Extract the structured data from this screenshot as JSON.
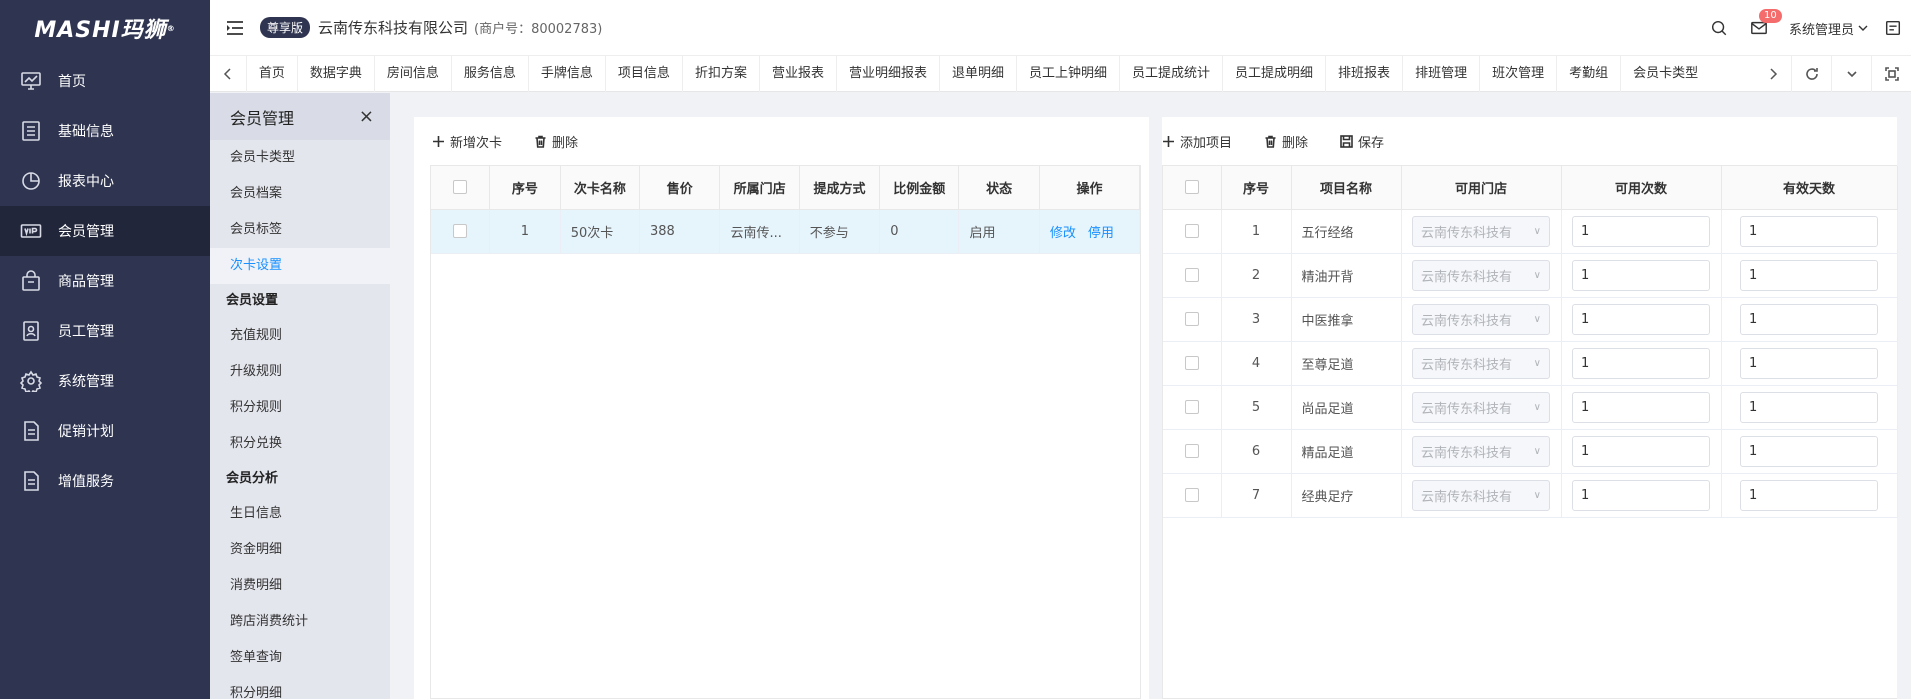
{
  "sidebar": {
    "logo": "MASHI玛狮",
    "logo_mark": "®",
    "items": [
      {
        "label": "首页",
        "icon": "chart-monitor-icon"
      },
      {
        "label": "基础信息",
        "icon": "document-list-icon"
      },
      {
        "label": "报表中心",
        "icon": "pie-chart-icon"
      },
      {
        "label": "会员管理",
        "icon": "vip-card-icon",
        "active": true
      },
      {
        "label": "商品管理",
        "icon": "shopping-bag-icon"
      },
      {
        "label": "员工管理",
        "icon": "employee-card-icon"
      },
      {
        "label": "系统管理",
        "icon": "gear-icon"
      },
      {
        "label": "促销计划",
        "icon": "document-icon"
      },
      {
        "label": "增值服务",
        "icon": "document-icon"
      }
    ]
  },
  "header": {
    "edition": "尊享版",
    "company": "云南传东科技有限公司",
    "merchant": "(商户号：80002783)",
    "mail_count": "10",
    "user": "系统管理员"
  },
  "tabs": [
    "首页",
    "数据字典",
    "房间信息",
    "服务信息",
    "手牌信息",
    "项目信息",
    "折扣方案",
    "营业报表",
    "营业明细报表",
    "退单明细",
    "员工上钟明细",
    "员工提成统计",
    "员工提成明细",
    "排班报表",
    "排班管理",
    "班次管理",
    "考勤组",
    "会员卡类型"
  ],
  "submenu": {
    "title": "会员管理",
    "close": "×",
    "items": [
      {
        "type": "item",
        "label": "会员卡类型"
      },
      {
        "type": "item",
        "label": "会员档案"
      },
      {
        "type": "item",
        "label": "会员标签"
      },
      {
        "type": "item",
        "label": "次卡设置",
        "active": true
      },
      {
        "type": "group",
        "label": "会员设置"
      },
      {
        "type": "item",
        "label": "充值规则"
      },
      {
        "type": "item",
        "label": "升级规则"
      },
      {
        "type": "item",
        "label": "积分规则"
      },
      {
        "type": "item",
        "label": "积分兑换"
      },
      {
        "type": "group",
        "label": "会员分析"
      },
      {
        "type": "item",
        "label": "生日信息"
      },
      {
        "type": "item",
        "label": "资金明细"
      },
      {
        "type": "item",
        "label": "消费明细"
      },
      {
        "type": "item",
        "label": "跨店消费统计"
      },
      {
        "type": "item",
        "label": "签单查询"
      },
      {
        "type": "item",
        "label": "积分明细"
      }
    ]
  },
  "left_panel": {
    "toolbar": {
      "add": "新增次卡",
      "delete": "删除"
    },
    "columns": [
      "序号",
      "次卡名称",
      "售价",
      "所属门店",
      "提成方式",
      "比例金额",
      "状态",
      "操作"
    ],
    "rows": [
      {
        "no": "1",
        "name": "50次卡",
        "price": "388",
        "store": "云南传...",
        "commission": "不参与",
        "ratio": "0",
        "status": "启用",
        "edit": "修改",
        "disable": "停用"
      }
    ]
  },
  "right_panel": {
    "toolbar": {
      "add": "添加项目",
      "delete": "删除",
      "save": "保存"
    },
    "columns": [
      "序号",
      "项目名称",
      "可用门店",
      "可用次数",
      "有效天数"
    ],
    "rows": [
      {
        "no": "1",
        "name": "五行经络",
        "store": "云南传东科技有",
        "times": "1",
        "days": "1"
      },
      {
        "no": "2",
        "name": "精油开背",
        "store": "云南传东科技有",
        "times": "1",
        "days": "1"
      },
      {
        "no": "3",
        "name": "中医推拿",
        "store": "云南传东科技有",
        "times": "1",
        "days": "1"
      },
      {
        "no": "4",
        "name": "至尊足道",
        "store": "云南传东科技有",
        "times": "1",
        "days": "1"
      },
      {
        "no": "5",
        "name": "尚品足道",
        "store": "云南传东科技有",
        "times": "1",
        "days": "1"
      },
      {
        "no": "6",
        "name": "精品足道",
        "store": "云南传东科技有",
        "times": "1",
        "days": "1"
      },
      {
        "no": "7",
        "name": "经典足疗",
        "store": "云南传东科技有",
        "times": "1",
        "days": "1"
      }
    ]
  }
}
